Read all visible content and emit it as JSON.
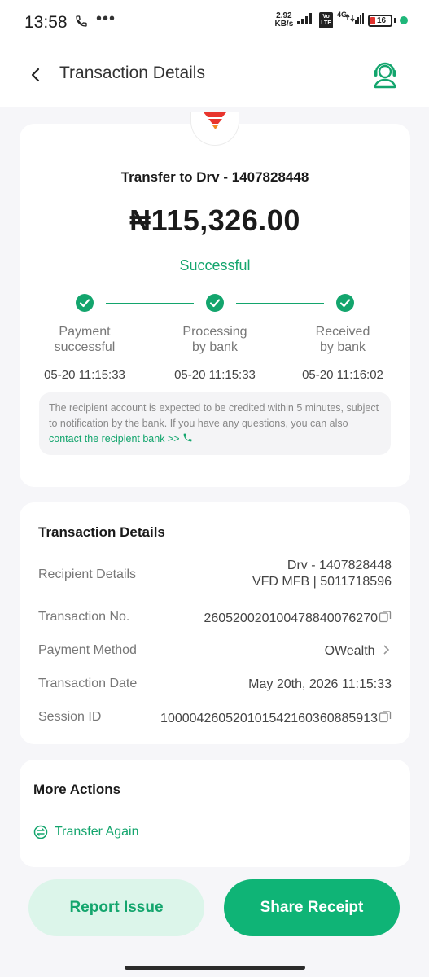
{
  "status_bar": {
    "time": "13:58",
    "dots": "•••",
    "net_speed_value": "2.92",
    "net_speed_unit": "KB/s",
    "volte_top": "Vo",
    "volte_bottom": "LTE",
    "network": "4G",
    "battery": "16"
  },
  "header": {
    "title": "Transaction Details"
  },
  "summary": {
    "title": "Transfer to Drv - 1407828448",
    "amount": "₦115,326.00",
    "status": "Successful",
    "steps": [
      {
        "label_line1": "Payment",
        "label_line2": "successful",
        "time": "05-20 11:15:33"
      },
      {
        "label_line1": "Processing",
        "label_line2": "by bank",
        "time": "05-20 11:15:33"
      },
      {
        "label_line1": "Received",
        "label_line2": "by bank",
        "time": "05-20 11:16:02"
      }
    ],
    "notice_text": "The recipient account is expected to be credited within 5 minutes, subject to notification by the bank. If you have any questions, you can also ",
    "notice_link": "contact the recipient bank >>"
  },
  "details": {
    "title": "Transaction Details",
    "recipient_label": "Recipient Details",
    "recipient_name": "Drv - 1407828448",
    "recipient_bank": "VFD MFB | 5011718596",
    "txn_no_label": "Transaction No.",
    "txn_no_value": "260520020100478840076270",
    "payment_method_label": "Payment Method",
    "payment_method_value": "OWealth",
    "txn_date_label": "Transaction Date",
    "txn_date_value": "May 20th, 2026 11:15:33",
    "session_label": "Session ID",
    "session_value": "100004260520101542160360885913"
  },
  "more_actions": {
    "title": "More Actions",
    "transfer_again": "Transfer Again"
  },
  "buttons": {
    "report": "Report Issue",
    "share": "Share Receipt"
  },
  "colors": {
    "accent": "#13a56d",
    "accent_light": "#dcf5ea",
    "background": "#f6f6f9"
  }
}
